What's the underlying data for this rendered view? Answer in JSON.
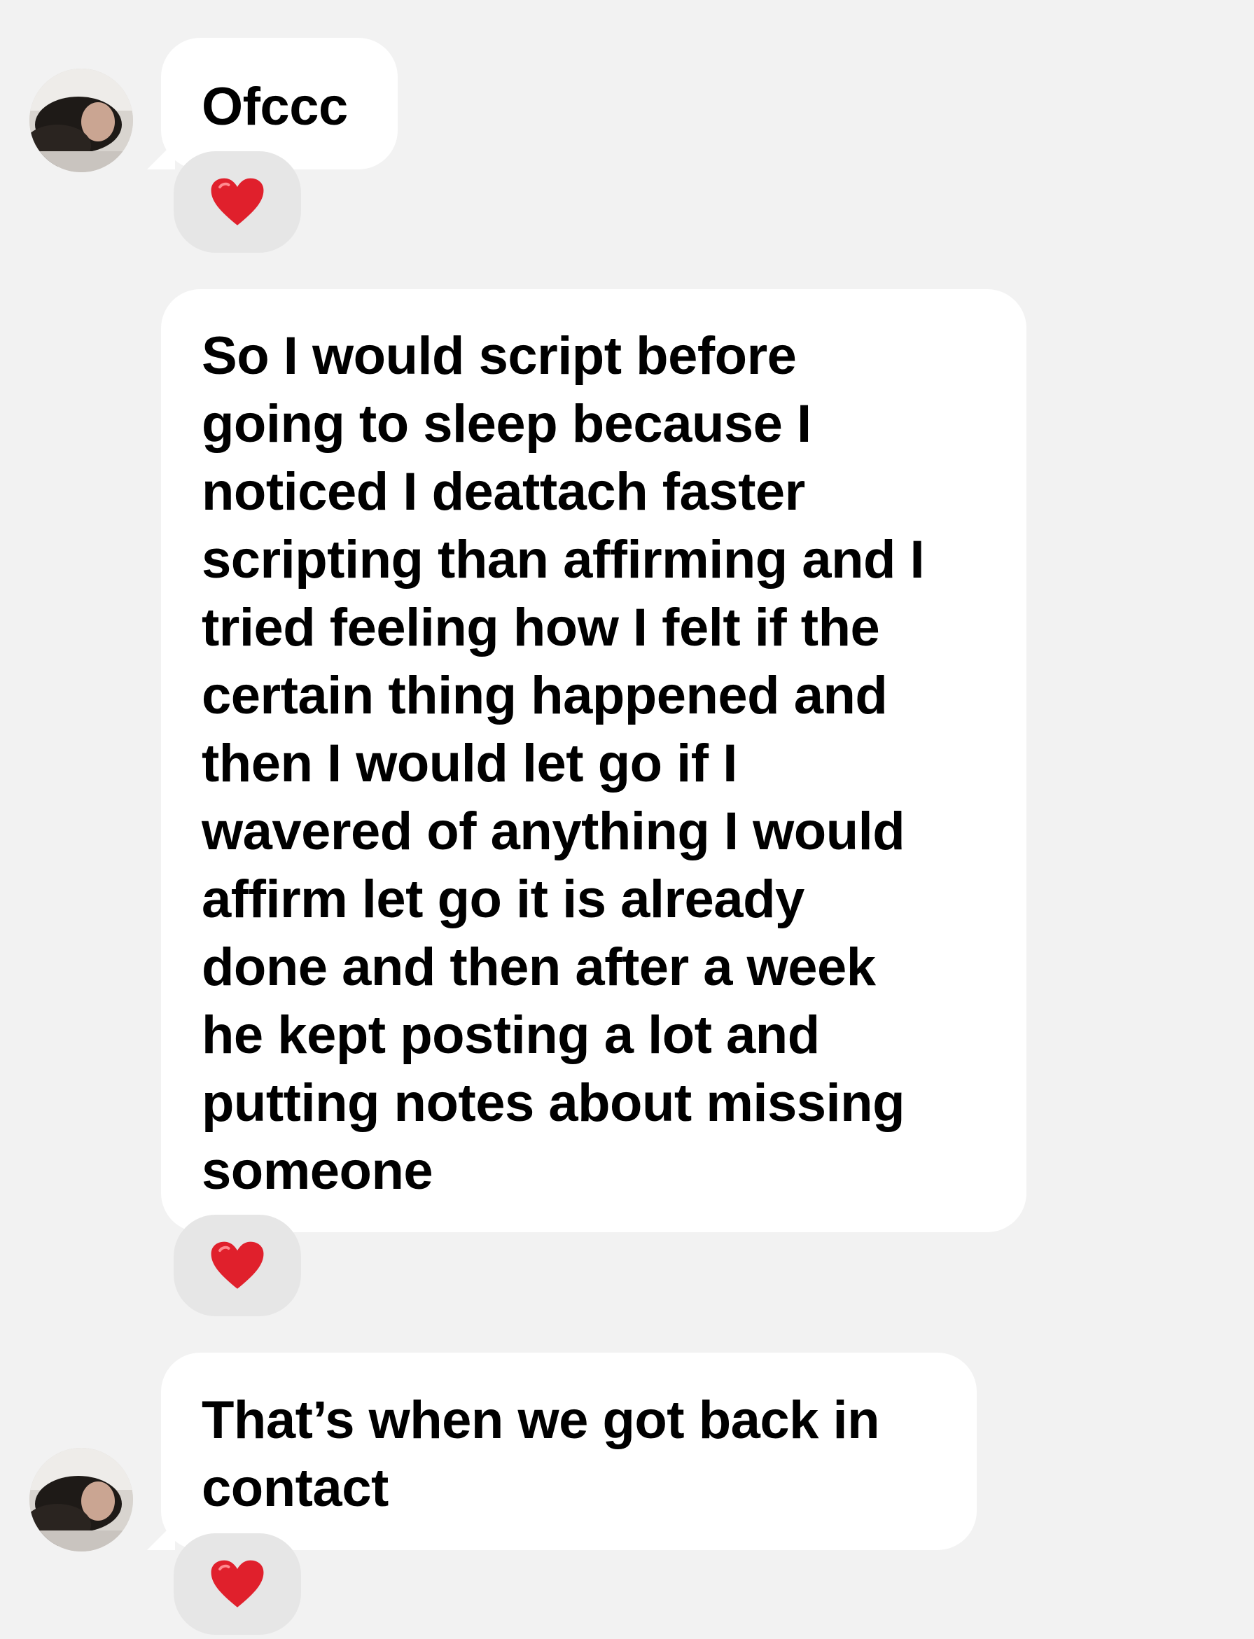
{
  "conversation": {
    "messages": [
      {
        "sender": "contact",
        "show_avatar": true,
        "text": "Ofccc",
        "reaction": "red-heart-icon"
      },
      {
        "sender": "contact",
        "show_avatar": false,
        "text": "So I would script before\ngoing to sleep because I\nnoticed I deattach  faster\nscripting than affirming and I\ntried  feeling how I felt if the\ncertain thing happened and\nthen I would let go if I\nwavered of anything I would\naffirm let go it is already\ndone and then after a week\nhe kept posting a lot and\nputting notes about missing\nsomeone",
        "reaction": "red-heart-icon"
      },
      {
        "sender": "contact",
        "show_avatar": true,
        "text": "That’s when we got back in\ncontact",
        "reaction": "red-heart-icon"
      }
    ]
  },
  "colors": {
    "background": "#f2f2f2",
    "bubble": "#ffffff",
    "reaction_pill": "#e6e6e6",
    "heart": "#e0202c"
  }
}
